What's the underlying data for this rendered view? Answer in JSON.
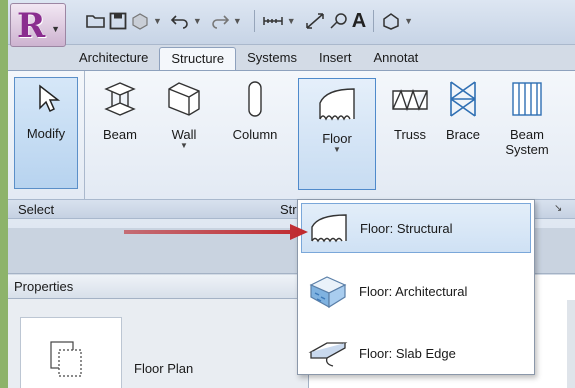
{
  "app": {
    "logo_letter": "R",
    "accent": "#8a2d8f"
  },
  "quick_access": {
    "icons": [
      "open-icon",
      "save-icon",
      "sync-icon",
      "undo-icon",
      "redo-icon",
      "measure-icon",
      "dimension-icon",
      "tag-icon",
      "text-icon",
      "3d-view-icon"
    ],
    "text_button": "A"
  },
  "tabs": [
    "Architecture",
    "Structure",
    "Systems",
    "Insert",
    "Annotat"
  ],
  "active_tab": "Structure",
  "ribbon": {
    "tools": {
      "modify": "Modify",
      "beam": "Beam",
      "wall": "Wall",
      "column": "Column",
      "floor": "Floor",
      "truss": "Truss",
      "brace": "Brace",
      "beam_system": "Beam\nSystem"
    },
    "panels": {
      "select": "Select",
      "structure": "Str"
    }
  },
  "floor_menu": {
    "items": [
      {
        "label": "Floor: Structural",
        "icon": "floor-structural-icon",
        "highlighted": true
      },
      {
        "label": "Floor: Architectural",
        "icon": "floor-architectural-icon",
        "highlighted": false
      },
      {
        "label": "Floor: Slab Edge",
        "icon": "slab-edge-icon",
        "highlighted": false
      }
    ]
  },
  "properties": {
    "title": "Properties",
    "type_name": "Floor Plan"
  },
  "colors": {
    "background_frame": "#8db36a",
    "highlight": "#cfe1f4",
    "arrow": "#c0282d"
  }
}
